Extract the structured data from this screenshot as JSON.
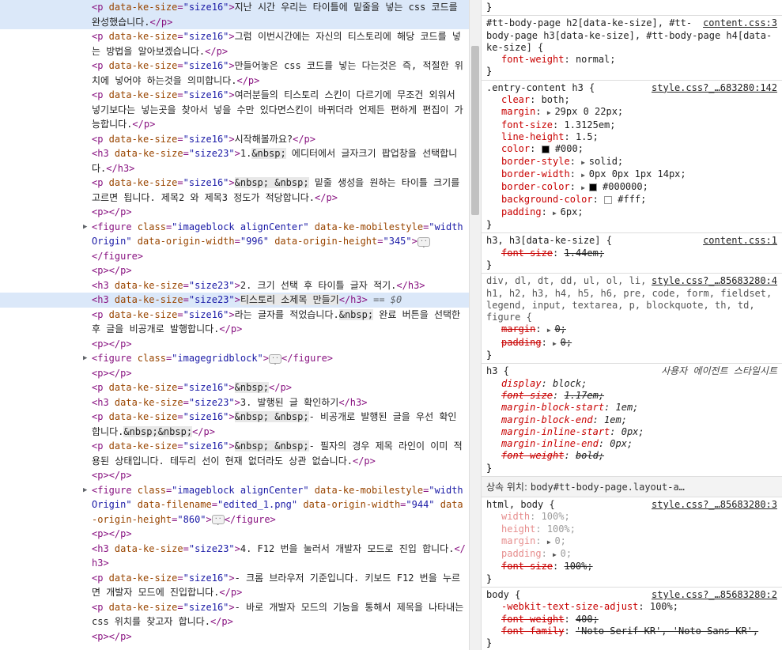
{
  "elements": {
    "lines": [
      {
        "o": "<p data-ke-size=\"size16\">",
        "t": "지난 시간 우리는 타이틀에 밑줄을 넣는 css 코드를 완성했습니다.",
        "c": "</p>",
        "hl": true
      },
      {
        "o": "<p data-ke-size=\"size16\">",
        "t": "그럼 이번시간에는 자신의 티스토리에 해당 코드를 넣는 방법을 알아보겠습니다.",
        "c": "</p>"
      },
      {
        "o": "<p data-ke-size=\"size16\">",
        "t": "만들어놓은 css 코드를 넣는 다는것은 즉, 적절한 위치에 넣어야 하는것을 의미합니다.",
        "c": "</p>"
      },
      {
        "o": "<p data-ke-size=\"size16\">",
        "t": "여러분들의 티스토리 스킨이 다르기에 무조건 외워서 넣기보다는 넣는곳을 찾아서 넣을 수만 있다면스킨이 바뀌더라 언제든 편하게 편집이 가능합니다.",
        "c": "</p>"
      },
      {
        "o": "<p data-ke-size=\"size16\">",
        "t": "시작해볼까요?",
        "c": "</p>"
      },
      {
        "o": "<h3 data-ke-size=\"size23\">",
        "t": "1.",
        "ent": "&nbsp;",
        "t2": " 에디터에서 글자크기 팝업창을 선택합니다.",
        "c": "</h3>"
      },
      {
        "o": "<p data-ke-size=\"size16\">",
        "ent": "&nbsp; &nbsp;",
        "t": " 밑줄 생성을 원하는 타이틀 크기를 고르면 됩니다. 제목2 와 제목3 정도가 적당합니다.",
        "c": "</p>",
        "entFirst": true
      },
      {
        "o": "<p>",
        "t": "",
        "c": "</p>"
      },
      {
        "tagline": "<figure class=\"imageblock alignCenter\" data-ke-mobilestyle=\"widthOrigin\" data-origin-width=\"996\" data-origin-height=\"345\">",
        "ell": true,
        "arrow": true
      },
      {
        "closeonly": "</figure>"
      },
      {
        "o": "<p>",
        "t": "",
        "c": "</p>"
      },
      {
        "o": "<h3 data-ke-size=\"size23\">",
        "t": "2. 크기 선택 후 타이틀 글자 적기.",
        "c": "</h3>"
      },
      {
        "o": "<h3 data-ke-size=\"size23\">",
        "t": "티스토리 소제목 만들기",
        "c": "</h3>",
        "hl": true,
        "eq": " == $0",
        "entWrap": true
      },
      {
        "o": "<p data-ke-size=\"size16\">",
        "t": "라는 글자를 적었습니다.",
        "ent": "&nbsp;",
        "t2": " 완료 버튼을 선택한 후 글을 비공개로 발행합니다.",
        "c": "</p>"
      },
      {
        "o": "<p>",
        "t": "",
        "c": "</p>"
      },
      {
        "tagline": "<figure class=\"imagegridblock\">",
        "ell": true,
        "arrow": true,
        "close": "</figure>"
      },
      {
        "o": "<p>",
        "t": "",
        "c": "</p>"
      },
      {
        "o": "<p data-ke-size=\"size16\">",
        "ent": "&nbsp;",
        "t": "",
        "c": "</p>",
        "entFirst": true
      },
      {
        "o": "<h3 data-ke-size=\"size23\">",
        "t": "3. 발행된 글 확인하기",
        "c": "</h3>"
      },
      {
        "o": "<p data-ke-size=\"size16\">",
        "ent": "&nbsp; &nbsp;",
        "t": "- 비공개로 발행된 글을 우선 확인 합니다.",
        "ent2": "&nbsp;&nbsp;",
        "c": "</p>",
        "entFirst": true
      },
      {
        "o": "<p data-ke-size=\"size16\">",
        "ent": "&nbsp; &nbsp;",
        "t": "- 필자의 경우 제목 라인이 이미 적용된 상태입니다. 테두리 선이 현재 없더라도 상관 없습니다.",
        "c": "</p>",
        "entFirst": true
      },
      {
        "o": "<p>",
        "t": "",
        "c": "</p>"
      },
      {
        "tagline": "<figure class=\"imageblock alignCenter\" data-ke-mobilestyle=\"widthOrigin\" data-filename=\"edited_1.png\" data-origin-width=\"944\" data-origin-height=\"860\">",
        "ell": true,
        "arrow": true,
        "close": "</figure>"
      },
      {
        "o": "<p>",
        "t": "",
        "c": "</p>"
      },
      {
        "o": "<h3 data-ke-size=\"size23\">",
        "t": "4. F12 번을 눌러서 개발자 모드로 진입 합니다.",
        "c": "</h3>"
      },
      {
        "o": "<p data-ke-size=\"size16\">",
        "t": "- 크롬 브라우저 기준입니다. 키보드 F12 번을 누르면 개발자 모드에 진입합니다.",
        "c": "</p>"
      },
      {
        "o": "<p data-ke-size=\"size16\">",
        "t": "- 바로 개발자 모드의 기능을 통해서 제목을 나타내는 css 위치를 찾고자 합니다.",
        "c": "</p>"
      },
      {
        "o": "<p>",
        "t": "",
        "c": "</p>"
      }
    ]
  },
  "styles": {
    "top_brace": "}",
    "rule1": {
      "selector": "#tt-body-page h2[data-ke-size], #tt-body-page h3[data-ke-size], #tt-body-page h4[data-ke-size] {",
      "source": "content.css:3",
      "props": [
        {
          "n": "font-weight",
          "v": "normal;"
        }
      ]
    },
    "rule2": {
      "selector": ".entry-content h3 {",
      "source": "style.css?_…683280:142",
      "props": [
        {
          "n": "clear",
          "v": "both;"
        },
        {
          "n": "margin",
          "v": "29px 0 22px;",
          "tri": true
        },
        {
          "n": "font-size",
          "v": "1.3125em;"
        },
        {
          "n": "line-height",
          "v": "1.5;"
        },
        {
          "n": "color",
          "v": "#000;",
          "sw": "#000000"
        },
        {
          "n": "border-style",
          "v": "solid;",
          "tri": true
        },
        {
          "n": "border-width",
          "v": "0px 0px 1px 14px;",
          "tri": true
        },
        {
          "n": "border-color",
          "v": "#000000;",
          "tri": true,
          "sw": "#000000"
        },
        {
          "n": "background-color",
          "v": "#fff;",
          "sw": "#ffffff"
        },
        {
          "n": "padding",
          "v": "6px;",
          "tri": true
        }
      ]
    },
    "rule3": {
      "selector": "h3, h3[data-ke-size] {",
      "source": "content.css:1",
      "props": [
        {
          "n": "font-size",
          "v": "1.44em;",
          "strike": true
        }
      ]
    },
    "rule4": {
      "selector": "div, dl, dt, dd, ul, ol, li, h1, h2, h3, h4, h5, h6, pre, code, form, fieldset, legend, input, textarea, p, blockquote, th, td, figure {",
      "source": "style.css?_…85683280:4",
      "props": [
        {
          "n": "margin",
          "v": "0;",
          "tri": true,
          "strike": true
        },
        {
          "n": "padding",
          "v": "0;",
          "tri": true,
          "strike": true
        }
      ]
    },
    "rule5": {
      "selector": "h3 {",
      "ua_note": "사용자 에이전트 스타일시트",
      "props": [
        {
          "n": "display",
          "v": "block;"
        },
        {
          "n": "font-size",
          "v": "1.17em;",
          "strike": true
        },
        {
          "n": "margin-block-start",
          "v": "1em;"
        },
        {
          "n": "margin-block-end",
          "v": "1em;"
        },
        {
          "n": "margin-inline-start",
          "v": "0px;"
        },
        {
          "n": "margin-inline-end",
          "v": "0px;"
        },
        {
          "n": "font-weight",
          "v": "bold;",
          "strike": true
        }
      ]
    },
    "inherit": {
      "label": "상속 위치:",
      "selector": "body#tt-body-page.layout-a…"
    },
    "rule6": {
      "selector": "html, body {",
      "source": "style.css?_…85683280:3",
      "props": [
        {
          "n": "width",
          "v": "100%;",
          "dim": true
        },
        {
          "n": "height",
          "v": "100%;",
          "dim": true
        },
        {
          "n": "margin",
          "v": "0;",
          "tri": true,
          "dim": true
        },
        {
          "n": "padding",
          "v": "0;",
          "tri": true,
          "dim": true
        },
        {
          "n": "font-size",
          "v": "100%;",
          "strike": true
        }
      ]
    },
    "rule7": {
      "selector": "body {",
      "source": "style.css?_…85683280:2",
      "props": [
        {
          "n": "-webkit-text-size-adjust",
          "v": "100%;"
        },
        {
          "n": "font-weight",
          "v": "400;",
          "strike": true
        },
        {
          "n": "font-family",
          "v": "'Noto Serif KR', 'Noto Sans KR',",
          "strike": true
        }
      ]
    },
    "closing": "}"
  }
}
